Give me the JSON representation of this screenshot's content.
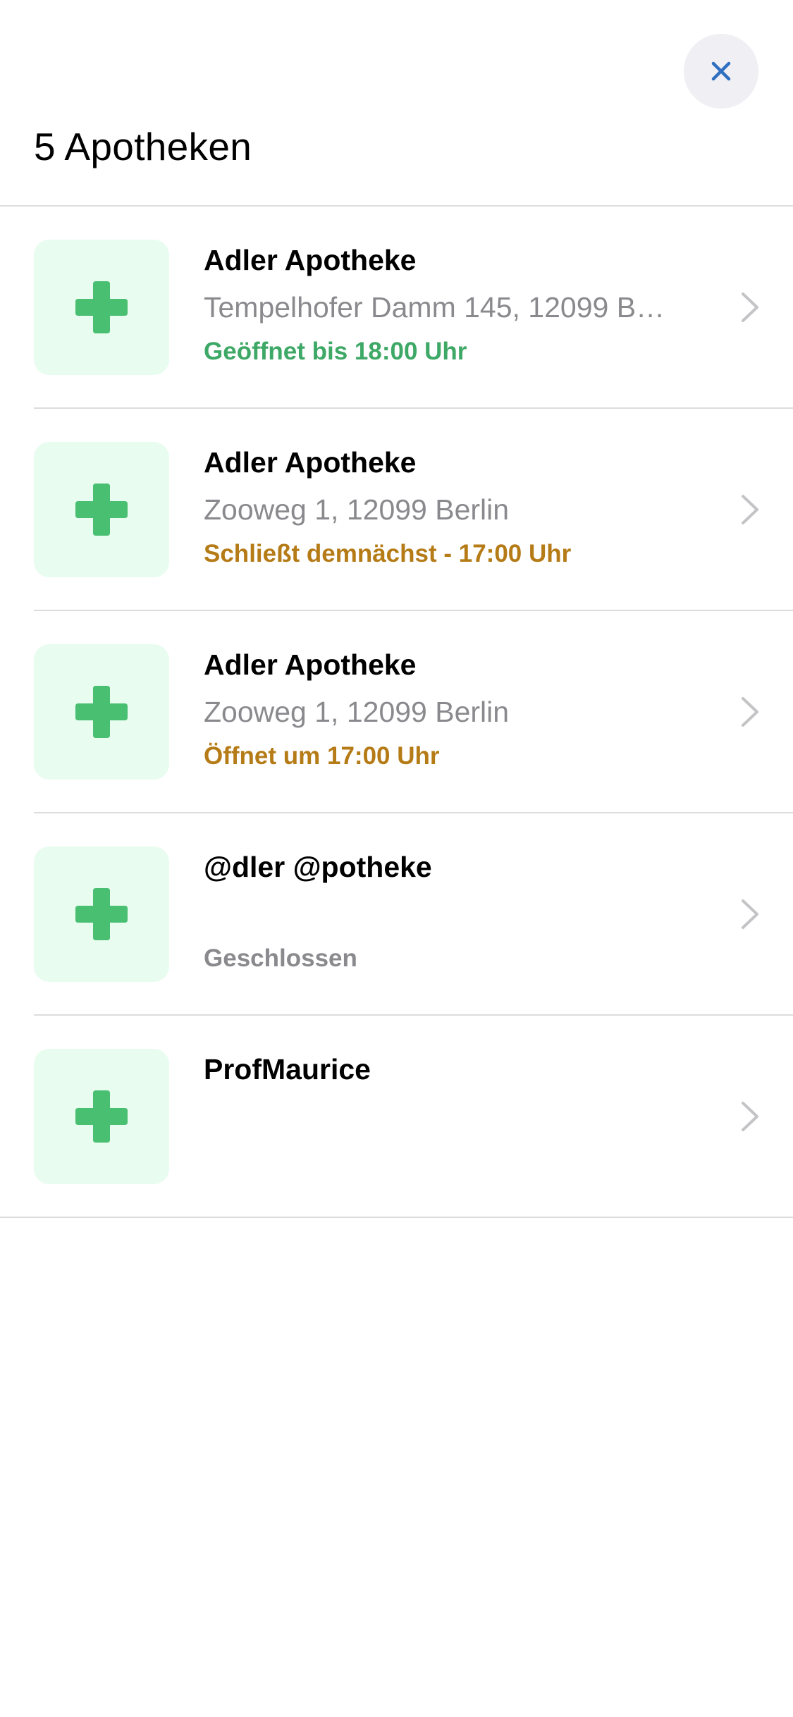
{
  "header": {
    "title": "5 Apotheken",
    "close_icon": "close-icon"
  },
  "colors": {
    "accent": "#2f6fc1",
    "open": "#3ea866",
    "warning": "#b57b16",
    "closed": "#8a8a8e",
    "thumb_bg": "#e8fcef",
    "cross": "#48bf71"
  },
  "pharmacies": [
    {
      "name": "Adler Apotheke",
      "address": "Tempelhofer Damm 145, 12099 Berlin",
      "status": "Geöffnet bis 18:00 Uhr",
      "status_type": "open",
      "icon": "pharmacy-cross-icon"
    },
    {
      "name": "Adler Apotheke",
      "address": "Zooweg 1, 12099 Berlin",
      "status": "Schließt demnächst - 17:00 Uhr",
      "status_type": "warning",
      "icon": "pharmacy-cross-icon"
    },
    {
      "name": "Adler Apotheke",
      "address": "Zooweg 1, 12099 Berlin",
      "status": "Öffnet um 17:00 Uhr",
      "status_type": "warning",
      "icon": "pharmacy-cross-icon"
    },
    {
      "name": "@dler @potheke",
      "address": "",
      "status": "Geschlossen",
      "status_type": "closed",
      "icon": "pharmacy-cross-icon"
    },
    {
      "name": "ProfMaurice",
      "address": "",
      "status": "",
      "status_type": "none",
      "icon": "pharmacy-cross-icon"
    }
  ]
}
